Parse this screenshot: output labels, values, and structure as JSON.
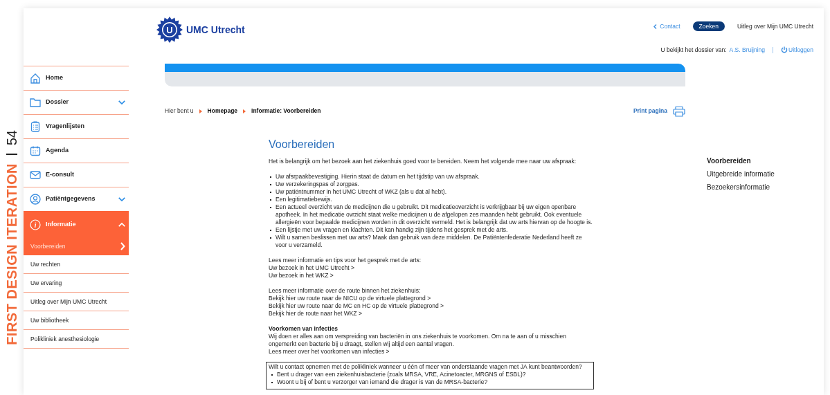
{
  "side_label": {
    "title": "FIRST DESIGN ITERATION",
    "page": "54"
  },
  "logo": {
    "mark": "U",
    "name": "UMC Utrecht"
  },
  "top_links": [
    {
      "kind": "link",
      "label": "Contact"
    },
    {
      "kind": "button",
      "label": "Zoeken"
    },
    {
      "kind": "text",
      "label": "Uitleg over Mijn UMC Utrecht"
    }
  ],
  "account": {
    "prefix": "U bekijkt het dossier van:",
    "name": "A.S. Bruijning",
    "logout": "Uitloggen"
  },
  "sidebar": {
    "items": [
      {
        "label": "Home",
        "kind": "link"
      },
      {
        "label": "Dossier",
        "kind": "group",
        "expanded": false
      },
      {
        "label": "Vragenlijsten",
        "kind": "link"
      },
      {
        "label": "Agenda",
        "kind": "link"
      },
      {
        "label": "E-consult",
        "kind": "link"
      },
      {
        "label": "Patiëntgegevens",
        "kind": "group",
        "expanded": false
      },
      {
        "label": "Informatie",
        "kind": "group",
        "expanded": true,
        "children": [
          {
            "label": "Voorbereiden",
            "selected": true
          },
          {
            "label": "Uw rechten",
            "selected": false
          },
          {
            "label": "Uw ervaring",
            "selected": false
          },
          {
            "label": "Uitleg over Mijn UMC Utrecht",
            "selected": false
          },
          {
            "label": "Uw bibliotheek",
            "selected": false
          },
          {
            "label": "Polikliniek anesthesiologie",
            "selected": false
          }
        ]
      }
    ]
  },
  "breadcrumb": {
    "lead": "Hier bent u",
    "items": [
      "Homepage",
      "Informatie: Voorbereiden"
    ]
  },
  "print": "Print pagina",
  "article": {
    "title": "Voorbereiden",
    "intro": "Het is belangrijk om het bezoek aan het ziekenhuis goed voor te bereiden. Neem het volgende mee naar uw afspraak:",
    "bullets": [
      "Uw afsrpaakbevestiging. Hierin staat de datum en het tijdstip van uw afspraak.",
      "Uw verzekeringspas of zorgpas.",
      "Uw patiëntnummer in het UMC Utrecht of WKZ (als u dat al hebt).",
      "Een legitimatiebewijs.",
      "Een actueel overzicht van de medicijnen die u gebruikt. Dit medicatieoverzicht is verkrijgbaar bij uw eigen openbare apotheek. In het medicatie ovrzicht staat welke medicijnen u de afgelopen zes maanden hebt gebruikt. Ook eventuele allergieën voor bepaalde medicijnen worden in dit overzicht vermeld. Het is belangrijk dat uw arts hiervan op de hoogte is.",
      "Een lijstje met uw vragen en klachten. Dit kan handig zijn tijdens het gesprek met de arts.",
      "Wilt u samen beslissen met uw arts? Maak dan gebruik van deze middelen. De Patiëntenfederatie Nederland heeft ze voor u verzameld."
    ],
    "link_groups": [
      {
        "lead": "Lees meer informatie en tips voor het gesprek met de arts:",
        "links": [
          "Uw bezoek in het UMC Utrecht >",
          "Uw bezoek in het WKZ >"
        ]
      },
      {
        "lead": "Lees meer informatie over de route binnen het ziekenhuis:",
        "links": [
          "Bekijk hier uw route naar de NICU op de virtuele plattegrond >",
          "Bekijk hier uw route naar de MC en HC op de virtuele plattegrond >",
          "Bekijk hier de route naar het WKZ >"
        ]
      }
    ],
    "infection": {
      "heading": "Voorkomen van infecties",
      "text": "Wij doen er alles aan om verspreiding van bacteriën in ons ziekenhuis te voorkomen. Om na te aan of u misschien ongemerkt een bacterie bij u draagt, stellen wij altijd een aantal vragen.",
      "link": "Lees meer over het voorkomen van infecties >"
    },
    "notice": {
      "question": "Wilt u contact opnemen met de polikliniek wanneer u één of meer van onderstaande vragen met JA kunt beantwoorden?",
      "bullets": [
        "Bent u drager van een ziekenhuisbacterie (zoals MRSA, VRE, Acinetoacter, MRGNS of ESBL)?",
        "Woont u bij of bent u verzorger van iemand die drager is van de MRSA-bacterie?"
      ]
    }
  },
  "toc": [
    {
      "label": "Voorbereiden",
      "selected": true
    },
    {
      "label": "Uitgebreide informatie",
      "selected": false
    },
    {
      "label": "Bezoekersinformatie",
      "selected": false
    }
  ]
}
